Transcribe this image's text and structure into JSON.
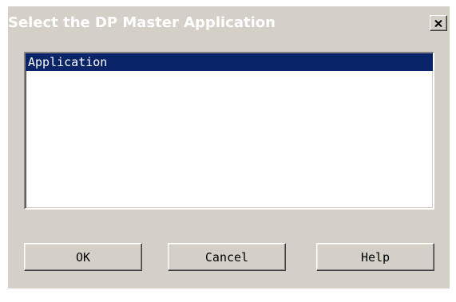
{
  "dialog": {
    "title": "Select the DP Master Application",
    "close_icon": "close-icon"
  },
  "list": {
    "items": [
      {
        "label": "Application",
        "selected": true
      }
    ]
  },
  "buttons": {
    "ok_label": "OK",
    "cancel_label": "Cancel",
    "help_label": "Help"
  },
  "colors": {
    "dialog_bg": "#d4d0c8",
    "selection_bg": "#0a246a",
    "selection_text": "#ffffff",
    "list_bg": "#ffffff"
  }
}
